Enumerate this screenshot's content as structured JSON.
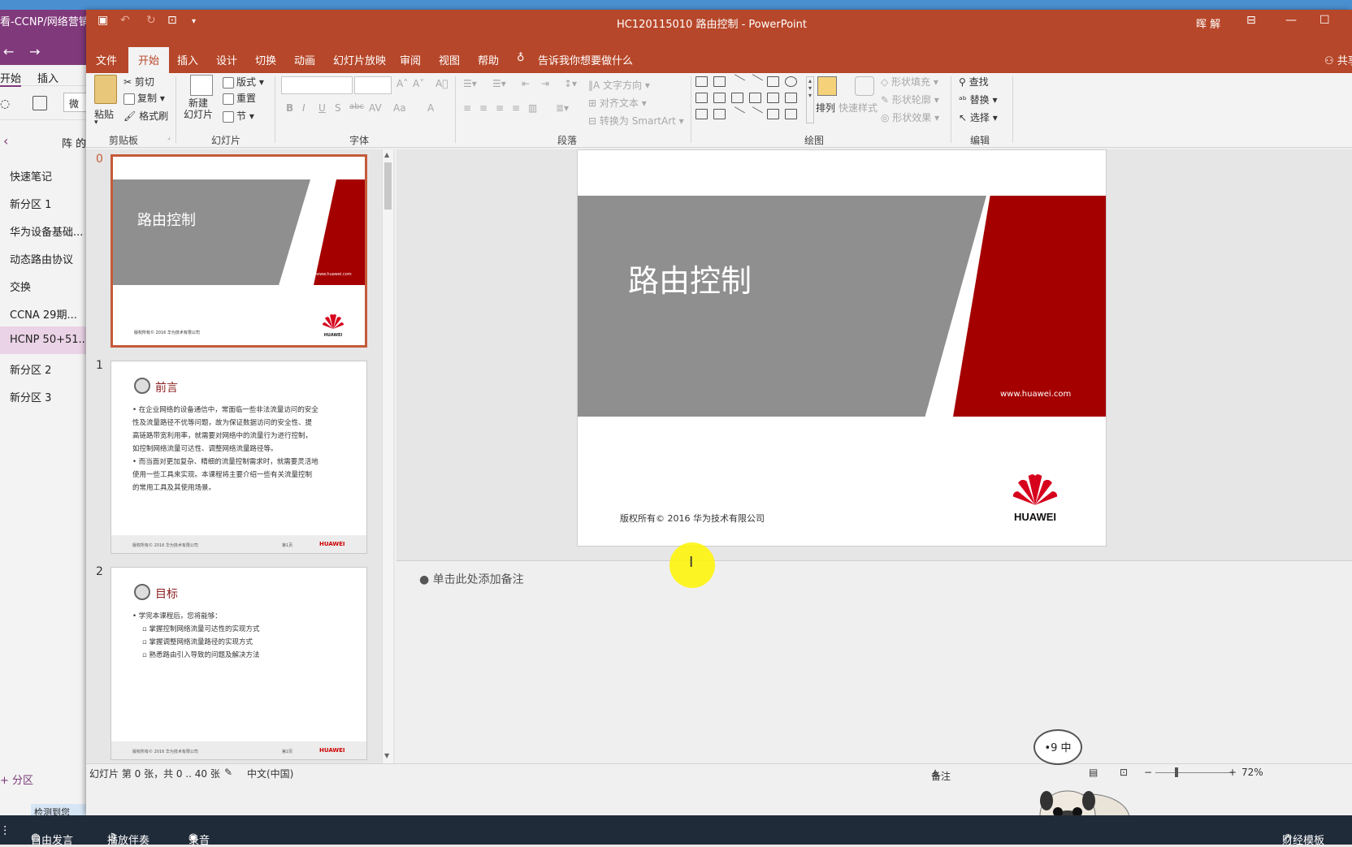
{
  "onenote": {
    "title": "看-CCNP/网络营销",
    "tabs": [
      "开始",
      "插入"
    ],
    "font_box": "微",
    "section_header": "阵 的",
    "sections": [
      "快速笔记",
      "新分区 1",
      "华为设备基础...",
      "动态路由协议",
      "交换",
      "CCNA  29期...",
      "HCNP 50+51...",
      "新分区 2",
      "新分区 3"
    ],
    "selected_section": 6,
    "add_section": "+ 分区",
    "detect_text": "检测到您"
  },
  "ppt": {
    "title": "HC120115010  路由控制  -  PowerPoint",
    "user": "晖 解",
    "menu": [
      "文件",
      "开始",
      "插入",
      "设计",
      "切换",
      "动画",
      "幻灯片放映",
      "审阅",
      "视图",
      "帮助"
    ],
    "active_menu": "开始",
    "tell_me": "告诉我你想要做什么",
    "share": "共享",
    "ribbon": {
      "clipboard": {
        "paste": "粘贴",
        "cut": "剪切",
        "copy": "复制",
        "format_painter": "格式刷",
        "label": "剪贴板"
      },
      "slides": {
        "new_slide": "新建\n幻灯片",
        "layout": "版式",
        "reset": "重置",
        "section": "节",
        "label": "幻灯片"
      },
      "font": {
        "label": "字体",
        "buttons": [
          "B",
          "I",
          "U",
          "S",
          "abc",
          "AV",
          "Aa",
          "A"
        ]
      },
      "paragraph": {
        "label": "段落",
        "text_direction": "文字方向",
        "align_text": "对齐文本",
        "smartart": "转换为 SmartArt"
      },
      "drawing": {
        "label": "绘图",
        "arrange": "排列",
        "quick_styles": "快速样式",
        "fill": "形状填充",
        "outline": "形状轮廓",
        "effects": "形状效果"
      },
      "editing": {
        "label": "编辑",
        "find": "查找",
        "replace": "替换",
        "select": "选择"
      }
    },
    "thumbnails": [
      {
        "number": "0",
        "title": "路由控制",
        "url": "www.huawei.com",
        "footer": "版权所有© 2016 华为技术有限公司"
      },
      {
        "number": "1",
        "heading": "前言",
        "bullets": [
          "在企业网络的设备通信中，常面临一些非法流量访问的安全\n性及流量路径不优等问题，故为保证数据访问的安全性、提\n高链路带宽利用率，就需要对网络中的流量行为进行控制，\n如控制网络流量可达性、调整网络流量路径等。",
          "而当面对更加复杂、精细的流量控制需求时，就需要灵活地\n使用一些工具来实现。本课程将主要介绍一些有关流量控制\n的常用工具及其使用场景。"
        ],
        "footer": "版权所有© 2016 华为技术有限公司",
        "page": "第1页"
      },
      {
        "number": "2",
        "heading": "目标",
        "intro": "学完本课程后，您将能够：",
        "bullets": [
          "掌握控制网络流量可达性的实现方式",
          "掌握调整网络流量路径的实现方式",
          "熟悉路由引入导致的问题及解决方法"
        ],
        "footer": "版权所有© 2016 华为技术有限公司",
        "page": "第2页"
      }
    ],
    "slide": {
      "title": "路由控制",
      "url": "www.huawei.com",
      "footer": "版权所有© 2016 华为技术有限公司",
      "logo_text": "HUAWEI"
    },
    "notes_placeholder": "单击此处添加备注",
    "status": {
      "slide_info": "幻灯片 第 0 张，共 0 .. 40 张",
      "language": "中文(中国)",
      "notes": "备注",
      "zoom": "72%"
    }
  },
  "mascot_bubble": "•9 中",
  "taskbar": [
    "自由发言",
    "播放伴奏",
    "录音",
    "财经模板"
  ],
  "colors": {
    "ppt_accent": "#b7472a",
    "huawei_red": "#a50000",
    "slide_gray": "#8f8f8f",
    "onenote_purple": "#80397b"
  }
}
